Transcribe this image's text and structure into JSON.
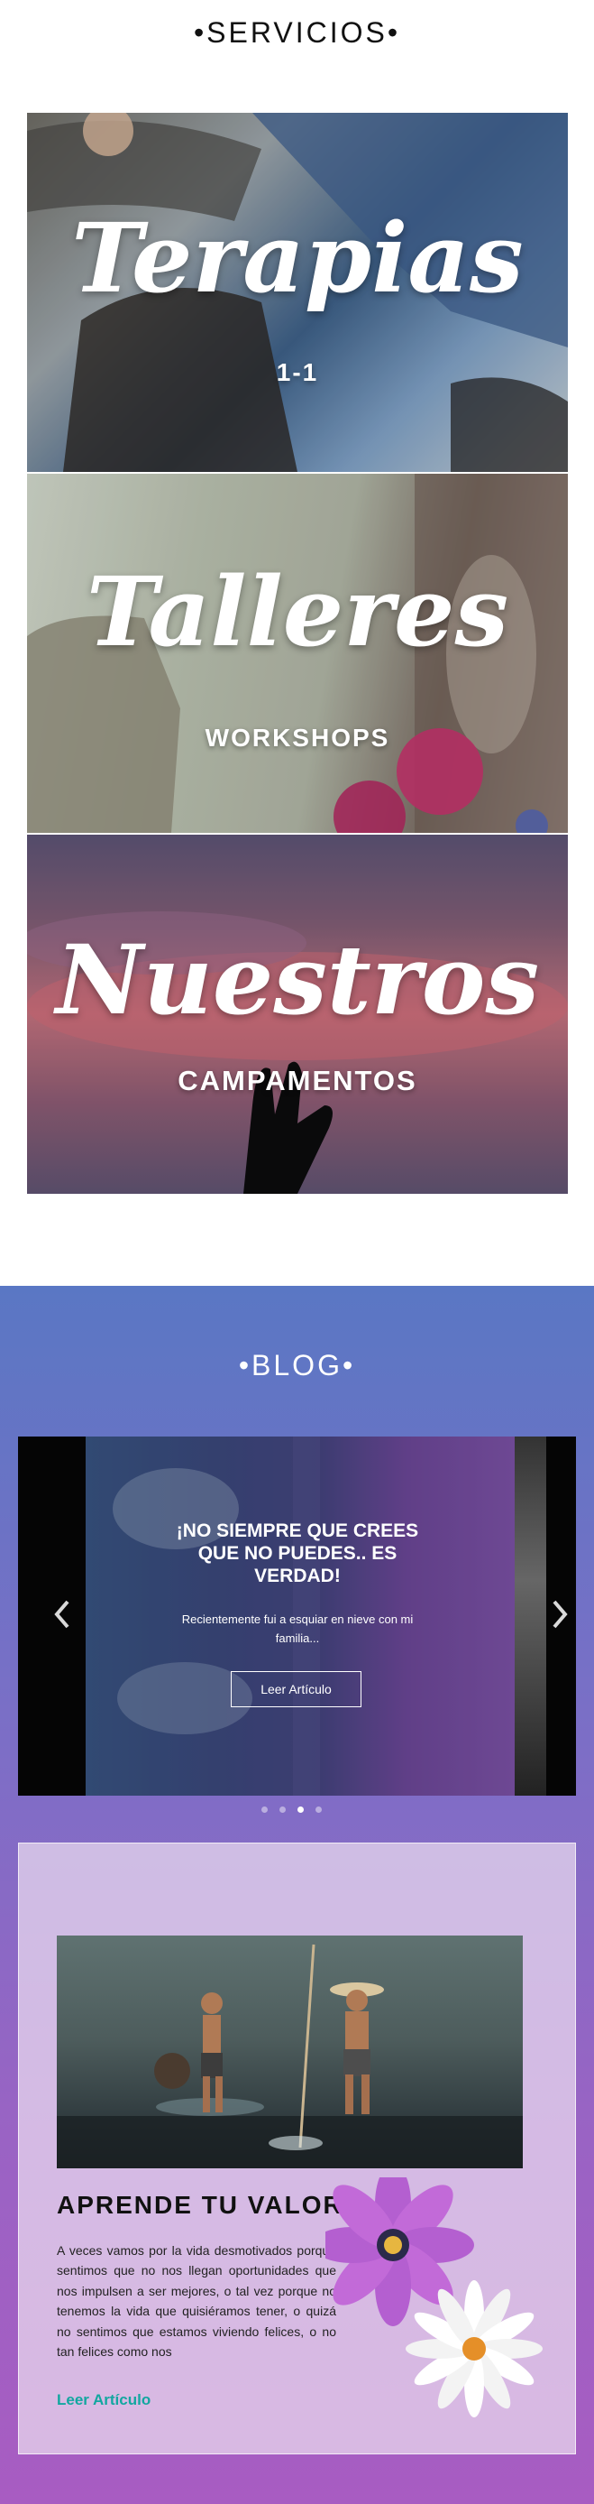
{
  "servicios": {
    "title": "•SERVICIOS•",
    "cards": [
      {
        "script": "Terapias",
        "subtitle": "1-1"
      },
      {
        "script": "Talleres",
        "subtitle": "WORKSHOPS"
      },
      {
        "script": "Nuestros",
        "subtitle": "CAMPAMENTOS"
      }
    ]
  },
  "blog": {
    "title": "•BLOG•",
    "slider": {
      "heading": "¡NO SIEMPRE QUE CREES QUE NO PUEDES.. ES VERDAD!",
      "text": "Recientemente fui a esquiar en nieve con mi familia...",
      "button": "Leer Artículo",
      "prev_icon": "chevron-left-icon",
      "next_icon": "chevron-right-icon",
      "dot_count": 4,
      "active_dot": 3
    },
    "article": {
      "title": "APRENDE TU VALOR",
      "text": "A veces vamos por la vida desmotivados porque sentimos que no nos llegan oportunidades que nos impulsen a ser mejores, o tal vez porque no tenemos la vida que quisiéramos tener, o quizá no sentimos que estamos viviendo felices, o no tan felices como nos",
      "link": "Leer Artículo"
    }
  },
  "colors": {
    "link": "#12a7a0",
    "blog_gradient_top": "#5a77c4",
    "blog_gradient_bottom": "#a85cc2"
  }
}
